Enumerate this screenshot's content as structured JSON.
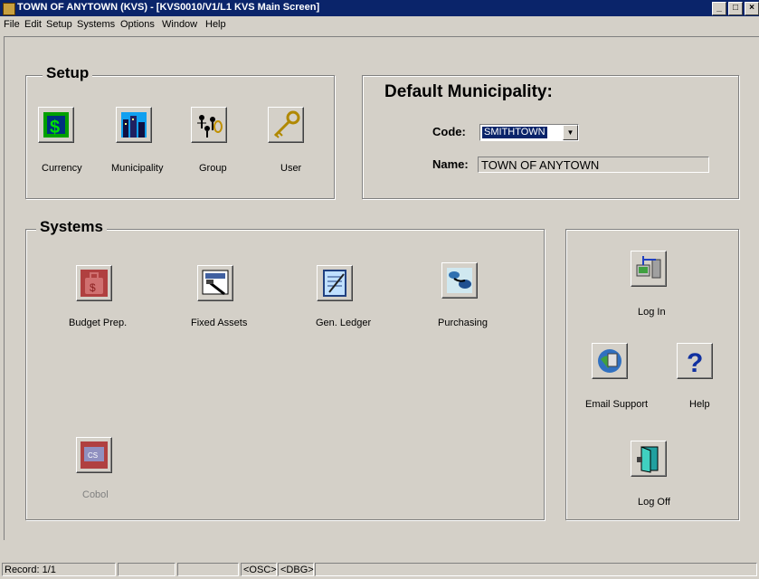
{
  "window": {
    "title": "TOWN OF ANYTOWN (KVS) - [KVS0010/V1/L1 KVS Main Screen]",
    "controls": {
      "minimize": "_",
      "maximize": "□",
      "close": "×"
    }
  },
  "menu": [
    "File",
    "Edit",
    "Setup",
    "Systems",
    "Options",
    "Window",
    "Help"
  ],
  "setup": {
    "heading": "Setup",
    "items": [
      {
        "label": "Currency",
        "icon": "currency-icon"
      },
      {
        "label": "Municipality",
        "icon": "municipality-icon"
      },
      {
        "label": "Group",
        "icon": "group-icon"
      },
      {
        "label": "User",
        "icon": "key-icon"
      }
    ]
  },
  "municipality": {
    "heading": "Default Municipality:",
    "code_label": "Code:",
    "code_value": "SMITHTOWN",
    "name_label": "Name:",
    "name_value": "TOWN OF ANYTOWN"
  },
  "systems": {
    "heading": "Systems",
    "items": [
      {
        "label": "Budget Prep.",
        "icon": "budget-icon"
      },
      {
        "label": "Fixed Assets",
        "icon": "fixed-assets-icon"
      },
      {
        "label": "Gen. Ledger",
        "icon": "ledger-icon"
      },
      {
        "label": "Purchasing",
        "icon": "purchasing-icon"
      },
      {
        "label": "Cobol",
        "icon": "cobol-icon",
        "disabled": true
      }
    ]
  },
  "actions": {
    "login": "Log In",
    "email_support": "Email Support",
    "help": "Help",
    "logoff": "Log Off"
  },
  "status": {
    "record": "Record: 1/1",
    "osc": "<OSC>",
    "dbg": "<DBG>"
  }
}
